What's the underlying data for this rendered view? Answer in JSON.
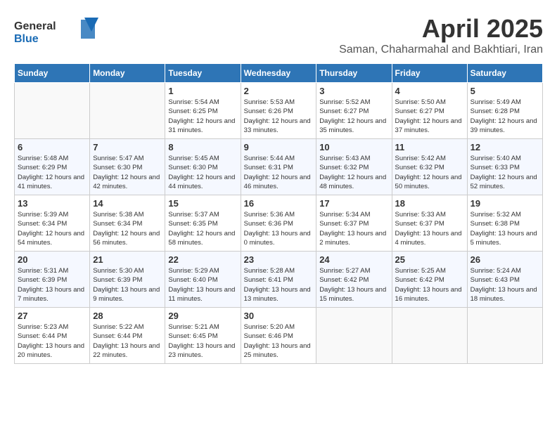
{
  "header": {
    "logo_line1": "General",
    "logo_line2": "Blue",
    "month": "April 2025",
    "location": "Saman, Chaharmahal and Bakhtiari, Iran"
  },
  "weekdays": [
    "Sunday",
    "Monday",
    "Tuesday",
    "Wednesday",
    "Thursday",
    "Friday",
    "Saturday"
  ],
  "weeks": [
    [
      {
        "day": "",
        "sunrise": "",
        "sunset": "",
        "daylight": ""
      },
      {
        "day": "",
        "sunrise": "",
        "sunset": "",
        "daylight": ""
      },
      {
        "day": "1",
        "sunrise": "Sunrise: 5:54 AM",
        "sunset": "Sunset: 6:25 PM",
        "daylight": "Daylight: 12 hours and 31 minutes."
      },
      {
        "day": "2",
        "sunrise": "Sunrise: 5:53 AM",
        "sunset": "Sunset: 6:26 PM",
        "daylight": "Daylight: 12 hours and 33 minutes."
      },
      {
        "day": "3",
        "sunrise": "Sunrise: 5:52 AM",
        "sunset": "Sunset: 6:27 PM",
        "daylight": "Daylight: 12 hours and 35 minutes."
      },
      {
        "day": "4",
        "sunrise": "Sunrise: 5:50 AM",
        "sunset": "Sunset: 6:27 PM",
        "daylight": "Daylight: 12 hours and 37 minutes."
      },
      {
        "day": "5",
        "sunrise": "Sunrise: 5:49 AM",
        "sunset": "Sunset: 6:28 PM",
        "daylight": "Daylight: 12 hours and 39 minutes."
      }
    ],
    [
      {
        "day": "6",
        "sunrise": "Sunrise: 5:48 AM",
        "sunset": "Sunset: 6:29 PM",
        "daylight": "Daylight: 12 hours and 41 minutes."
      },
      {
        "day": "7",
        "sunrise": "Sunrise: 5:47 AM",
        "sunset": "Sunset: 6:30 PM",
        "daylight": "Daylight: 12 hours and 42 minutes."
      },
      {
        "day": "8",
        "sunrise": "Sunrise: 5:45 AM",
        "sunset": "Sunset: 6:30 PM",
        "daylight": "Daylight: 12 hours and 44 minutes."
      },
      {
        "day": "9",
        "sunrise": "Sunrise: 5:44 AM",
        "sunset": "Sunset: 6:31 PM",
        "daylight": "Daylight: 12 hours and 46 minutes."
      },
      {
        "day": "10",
        "sunrise": "Sunrise: 5:43 AM",
        "sunset": "Sunset: 6:32 PM",
        "daylight": "Daylight: 12 hours and 48 minutes."
      },
      {
        "day": "11",
        "sunrise": "Sunrise: 5:42 AM",
        "sunset": "Sunset: 6:32 PM",
        "daylight": "Daylight: 12 hours and 50 minutes."
      },
      {
        "day": "12",
        "sunrise": "Sunrise: 5:40 AM",
        "sunset": "Sunset: 6:33 PM",
        "daylight": "Daylight: 12 hours and 52 minutes."
      }
    ],
    [
      {
        "day": "13",
        "sunrise": "Sunrise: 5:39 AM",
        "sunset": "Sunset: 6:34 PM",
        "daylight": "Daylight: 12 hours and 54 minutes."
      },
      {
        "day": "14",
        "sunrise": "Sunrise: 5:38 AM",
        "sunset": "Sunset: 6:34 PM",
        "daylight": "Daylight: 12 hours and 56 minutes."
      },
      {
        "day": "15",
        "sunrise": "Sunrise: 5:37 AM",
        "sunset": "Sunset: 6:35 PM",
        "daylight": "Daylight: 12 hours and 58 minutes."
      },
      {
        "day": "16",
        "sunrise": "Sunrise: 5:36 AM",
        "sunset": "Sunset: 6:36 PM",
        "daylight": "Daylight: 13 hours and 0 minutes."
      },
      {
        "day": "17",
        "sunrise": "Sunrise: 5:34 AM",
        "sunset": "Sunset: 6:37 PM",
        "daylight": "Daylight: 13 hours and 2 minutes."
      },
      {
        "day": "18",
        "sunrise": "Sunrise: 5:33 AM",
        "sunset": "Sunset: 6:37 PM",
        "daylight": "Daylight: 13 hours and 4 minutes."
      },
      {
        "day": "19",
        "sunrise": "Sunrise: 5:32 AM",
        "sunset": "Sunset: 6:38 PM",
        "daylight": "Daylight: 13 hours and 5 minutes."
      }
    ],
    [
      {
        "day": "20",
        "sunrise": "Sunrise: 5:31 AM",
        "sunset": "Sunset: 6:39 PM",
        "daylight": "Daylight: 13 hours and 7 minutes."
      },
      {
        "day": "21",
        "sunrise": "Sunrise: 5:30 AM",
        "sunset": "Sunset: 6:39 PM",
        "daylight": "Daylight: 13 hours and 9 minutes."
      },
      {
        "day": "22",
        "sunrise": "Sunrise: 5:29 AM",
        "sunset": "Sunset: 6:40 PM",
        "daylight": "Daylight: 13 hours and 11 minutes."
      },
      {
        "day": "23",
        "sunrise": "Sunrise: 5:28 AM",
        "sunset": "Sunset: 6:41 PM",
        "daylight": "Daylight: 13 hours and 13 minutes."
      },
      {
        "day": "24",
        "sunrise": "Sunrise: 5:27 AM",
        "sunset": "Sunset: 6:42 PM",
        "daylight": "Daylight: 13 hours and 15 minutes."
      },
      {
        "day": "25",
        "sunrise": "Sunrise: 5:25 AM",
        "sunset": "Sunset: 6:42 PM",
        "daylight": "Daylight: 13 hours and 16 minutes."
      },
      {
        "day": "26",
        "sunrise": "Sunrise: 5:24 AM",
        "sunset": "Sunset: 6:43 PM",
        "daylight": "Daylight: 13 hours and 18 minutes."
      }
    ],
    [
      {
        "day": "27",
        "sunrise": "Sunrise: 5:23 AM",
        "sunset": "Sunset: 6:44 PM",
        "daylight": "Daylight: 13 hours and 20 minutes."
      },
      {
        "day": "28",
        "sunrise": "Sunrise: 5:22 AM",
        "sunset": "Sunset: 6:44 PM",
        "daylight": "Daylight: 13 hours and 22 minutes."
      },
      {
        "day": "29",
        "sunrise": "Sunrise: 5:21 AM",
        "sunset": "Sunset: 6:45 PM",
        "daylight": "Daylight: 13 hours and 23 minutes."
      },
      {
        "day": "30",
        "sunrise": "Sunrise: 5:20 AM",
        "sunset": "Sunset: 6:46 PM",
        "daylight": "Daylight: 13 hours and 25 minutes."
      },
      {
        "day": "",
        "sunrise": "",
        "sunset": "",
        "daylight": ""
      },
      {
        "day": "",
        "sunrise": "",
        "sunset": "",
        "daylight": ""
      },
      {
        "day": "",
        "sunrise": "",
        "sunset": "",
        "daylight": ""
      }
    ]
  ]
}
